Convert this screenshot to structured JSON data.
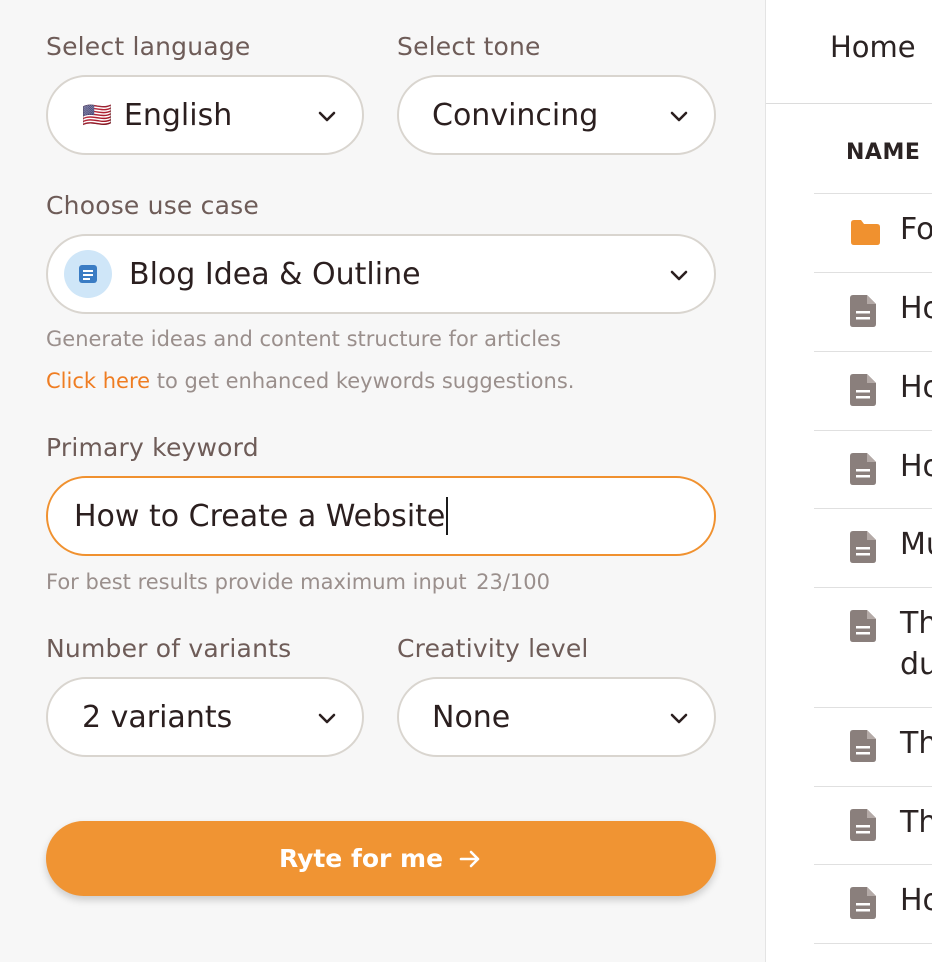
{
  "form": {
    "language": {
      "label": "Select language",
      "flag": "🇺🇸",
      "value": "English"
    },
    "tone": {
      "label": "Select tone",
      "value": "Convincing"
    },
    "use_case": {
      "label": "Choose use case",
      "icon": "document-icon",
      "value": "Blog Idea & Outline",
      "description": "Generate ideas and content structure for articles",
      "link_text": "Click here",
      "link_suffix": " to get enhanced keywords suggestions."
    },
    "keyword": {
      "label": "Primary keyword",
      "value": "How to Create a Website",
      "hint": "For best results provide maximum input",
      "counter": "23/100"
    },
    "variants": {
      "label": "Number of variants",
      "value": "2 variants"
    },
    "creativity": {
      "label": "Creativity level",
      "value": "None"
    },
    "submit_label": "Ryte for me"
  },
  "files": {
    "breadcrumb": "Home",
    "column_name": "NAME",
    "rows": [
      {
        "icon": "folder-icon",
        "text": "Fo"
      },
      {
        "icon": "file-icon",
        "text": "Ho"
      },
      {
        "icon": "file-icon",
        "text": "Ho"
      },
      {
        "icon": "file-icon",
        "text": "Ho"
      },
      {
        "icon": "file-icon",
        "text": "Mu"
      },
      {
        "icon": "file-icon",
        "text": "Th",
        "text2": "du"
      },
      {
        "icon": "file-icon",
        "text": "Th"
      },
      {
        "icon": "file-icon",
        "text": "Th"
      },
      {
        "icon": "file-icon",
        "text": "Ho"
      }
    ]
  },
  "colors": {
    "accent": "#f09433",
    "folder": "#f0912f",
    "file": "#8a7f7c"
  }
}
